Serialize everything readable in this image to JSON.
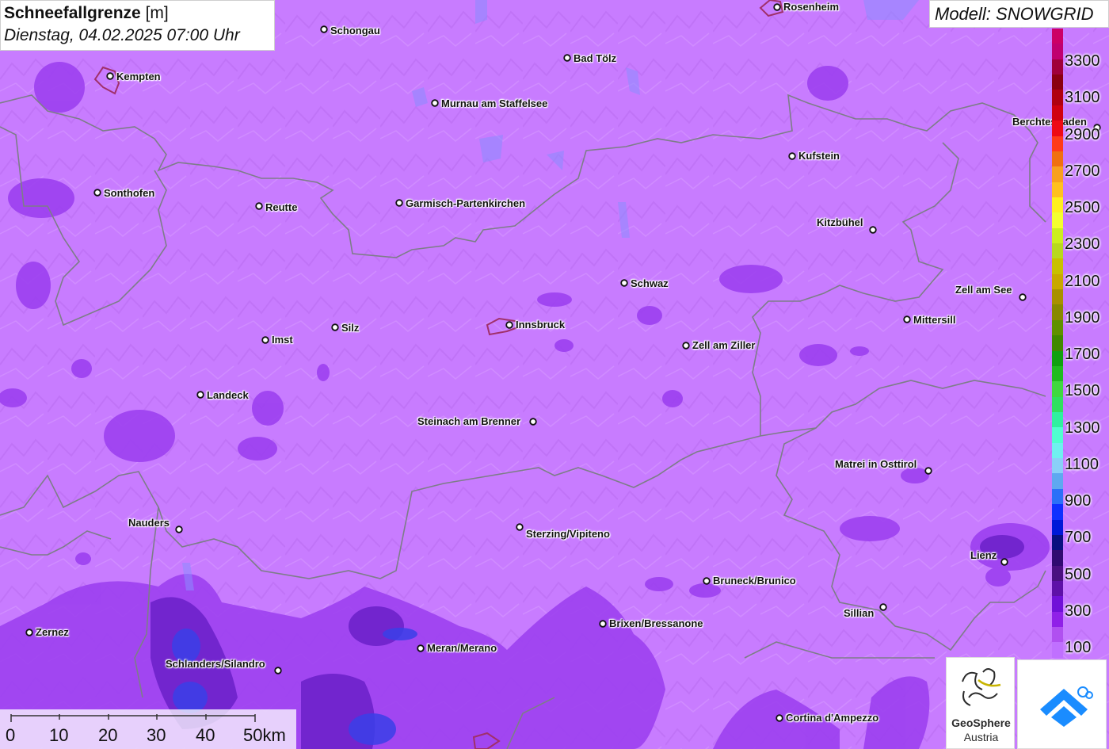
{
  "title": {
    "quantity": "Schneefallgrenze",
    "unit": "[m]",
    "datetime": "Dienstag, 04.02.2025 07:00 Uhr"
  },
  "model_label": "Modell: SNOWGRID",
  "cities": [
    {
      "name": "Rosenheim"
    },
    {
      "name": "Schongau"
    },
    {
      "name": "Bad Tölz"
    },
    {
      "name": "Kempten"
    },
    {
      "name": "Murnau am Staffelsee"
    },
    {
      "name": "Berchtesgaden"
    },
    {
      "name": "Kufstein"
    },
    {
      "name": "Sonthofen"
    },
    {
      "name": "Reutte"
    },
    {
      "name": "Garmisch-Partenkirchen"
    },
    {
      "name": "Kitzbühel"
    },
    {
      "name": "Schwaz"
    },
    {
      "name": "Zell am See"
    },
    {
      "name": "Mittersill"
    },
    {
      "name": "Innsbruck"
    },
    {
      "name": "Silz"
    },
    {
      "name": "Imst"
    },
    {
      "name": "Zell am Ziller"
    },
    {
      "name": "Landeck"
    },
    {
      "name": "Steinach am Brenner"
    },
    {
      "name": "Matrei in Osttirol"
    },
    {
      "name": "Nauders"
    },
    {
      "name": "Sterzing/Vipiteno"
    },
    {
      "name": "Lienz"
    },
    {
      "name": "Bruneck/Brunico"
    },
    {
      "name": "Sillian"
    },
    {
      "name": "Brixen/Bressanone"
    },
    {
      "name": "Zernez"
    },
    {
      "name": "Meran/Merano"
    },
    {
      "name": "Schlanders/Silandro"
    },
    {
      "name": "Cortina d'Ampezzo"
    }
  ],
  "legend": {
    "labels": [
      "3300",
      "3100",
      "2900",
      "2700",
      "2500",
      "2300",
      "2100",
      "1900",
      "1700",
      "1500",
      "1300",
      "1100",
      "900",
      "700",
      "500",
      "300",
      "100"
    ],
    "colors": [
      "#cc0066",
      "#c00070",
      "#a0003a",
      "#8a0010",
      "#b00010",
      "#d00010",
      "#ee0a14",
      "#ff3a1a",
      "#f07010",
      "#f8a020",
      "#ffc020",
      "#fff020",
      "#f4ff30",
      "#ccee20",
      "#b8d820",
      "#c8c000",
      "#c8a800",
      "#a89000",
      "#888800",
      "#609000",
      "#408800",
      "#10a010",
      "#20bb20",
      "#40d840",
      "#30e060",
      "#30f0a0",
      "#50ffd0",
      "#70f0f0",
      "#8ad0f8",
      "#5fa8f0",
      "#2c70f8",
      "#1030ff",
      "#0018d8",
      "#081080",
      "#300a70",
      "#4a1080",
      "#5e10a8",
      "#7010d8",
      "#9020e8",
      "#b050f0",
      "#c070ff"
    ]
  },
  "scalebar": {
    "labels": [
      "0",
      "10",
      "20",
      "30",
      "40",
      "50km"
    ]
  },
  "logos": {
    "geosphere_line1": "GeoSphere",
    "geosphere_line2": "Austria"
  },
  "colors": {
    "map_base": "#c87cff",
    "dark_purple": "#7a18e0",
    "blue_core": "#3a40e8",
    "border": "#7d7d88",
    "city_outline": "#a0306a",
    "app_logo_blue": "#1a8cff"
  }
}
